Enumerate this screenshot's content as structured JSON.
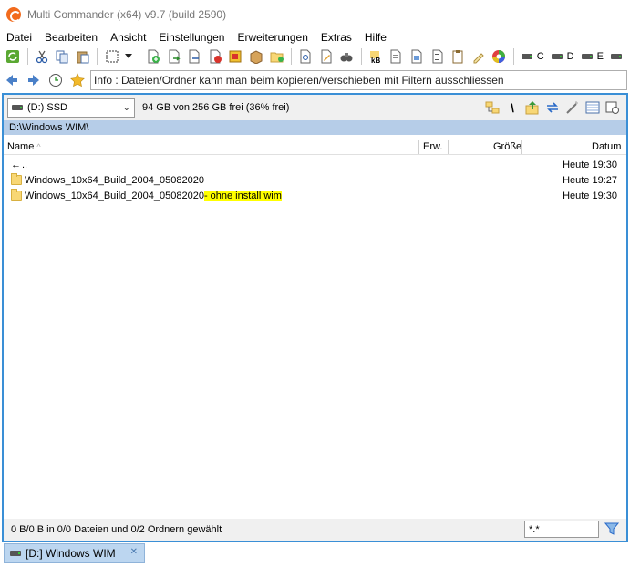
{
  "window": {
    "title": "Multi Commander (x64)  v9.7 (build 2590)"
  },
  "menu": [
    "Datei",
    "Bearbeiten",
    "Ansicht",
    "Einstellungen",
    "Erweiterungen",
    "Extras",
    "Hilfe"
  ],
  "toolbar": {
    "drives": [
      "C",
      "D",
      "E"
    ]
  },
  "infobar": {
    "text": "Info : Dateien/Ordner kann man beim kopieren/verschieben mit Filtern ausschliessen"
  },
  "panel": {
    "drive_label": "(D:) SSD",
    "free_space": "94 GB von 256 GB frei (36% frei)",
    "path": "D:\\Windows WIM\\",
    "columns": {
      "name": "Name",
      "ext": "Erw.",
      "size": "Größe",
      "date": "Datum"
    },
    "rows": [
      {
        "name": "..",
        "date": "Heute 19:30"
      },
      {
        "name": "Windows_10x64_Build_2004_05082020",
        "suffix": "",
        "date": "Heute 19:27"
      },
      {
        "name": "Windows_10x64_Build_2004_05082020",
        "suffix": " - ohne install wim",
        "date": "Heute 19:30"
      }
    ],
    "status": "0 B/0 B in 0/0 Dateien und 0/2 Ordnern gewählt",
    "filter_value": "*.*"
  },
  "tabs": [
    {
      "label": "[D:] Windows WIM"
    }
  ],
  "colors": {
    "accent": "#3a8fd6",
    "path_bar": "#b6cde8",
    "highlight": "#ffff00",
    "tab": "#bcd6f0"
  }
}
